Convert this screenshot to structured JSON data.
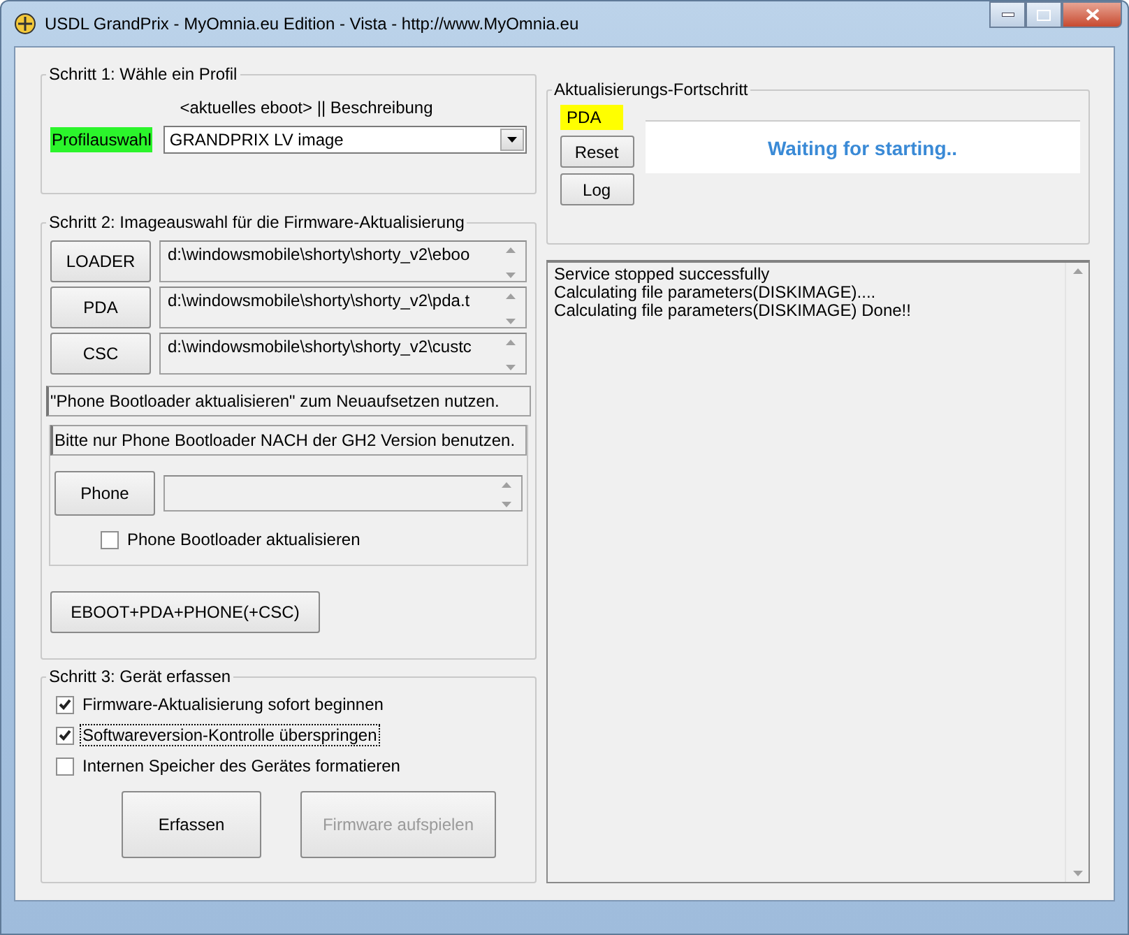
{
  "window": {
    "title": "USDL GrandPrix - MyOmnia.eu Edition - Vista - http://www.MyOmnia.eu"
  },
  "step1": {
    "title": "Schritt 1: Wähle ein Profil",
    "header": "<aktuelles eboot> || Beschreibung",
    "profile_label": "Profilauswahl",
    "profile_value": "GRANDPRIX LV image"
  },
  "step2": {
    "title": "Schritt 2: Imageauswahl für die Firmware-Aktualisierung",
    "images": [
      {
        "button": "LOADER",
        "path": "d:\\windowsmobile\\shorty\\shorty_v2\\eboo"
      },
      {
        "button": "PDA",
        "path": "d:\\windowsmobile\\shorty\\shorty_v2\\pda.t"
      },
      {
        "button": "CSC",
        "path": "d:\\windowsmobile\\shorty\\shorty_v2\\custc"
      }
    ],
    "note": "\"Phone Bootloader aktualisieren\" zum Neuaufsetzen nutzen.",
    "phone_group_title": "Bitte nur Phone Bootloader NACH der GH2 Version benutzen.",
    "phone_button": "Phone",
    "phone_checkbox": {
      "label": "Phone Bootloader aktualisieren",
      "checked": false
    },
    "combo_button": "EBOOT+PDA+PHONE(+CSC)"
  },
  "step3": {
    "title": "Schritt 3: Gerät erfassen",
    "options": [
      {
        "label": "Firmware-Aktualisierung sofort beginnen",
        "checked": true,
        "focused": false
      },
      {
        "label": "Softwareversion-Kontrolle überspringen",
        "checked": true,
        "focused": true
      },
      {
        "label": "Internen Speicher des Gerätes formatieren",
        "checked": false,
        "focused": false
      }
    ],
    "buttons": [
      {
        "label": "Erfassen",
        "disabled": false
      },
      {
        "label": "Firmware aufspielen",
        "disabled": true
      }
    ]
  },
  "progress": {
    "title": "Aktualisierungs-Fortschritt",
    "stage": "PDA",
    "buttons": [
      "Reset",
      "Log"
    ],
    "status": "Waiting for starting.."
  },
  "log": {
    "lines": [
      "Service stopped successfully",
      "Calculating file parameters(DISKIMAGE)....",
      "Calculating file parameters(DISKIMAGE) Done!!"
    ]
  }
}
